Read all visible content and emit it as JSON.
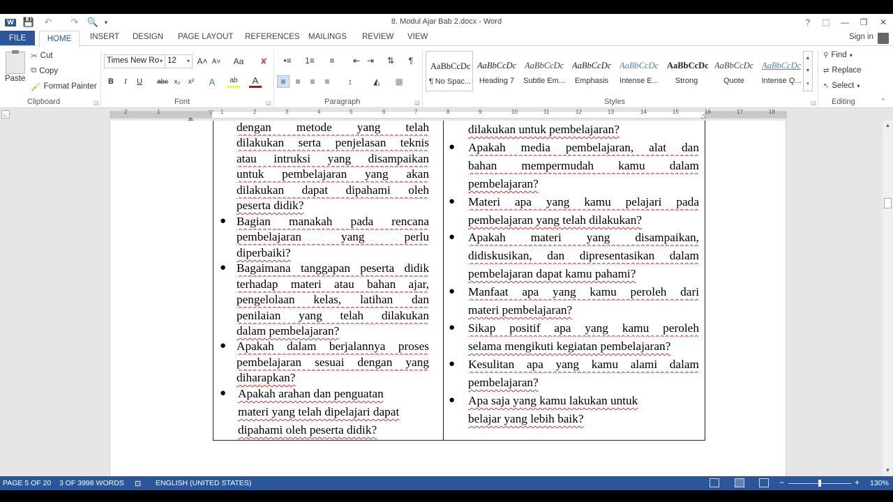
{
  "window": {
    "title": "8. Modul Ajar Bab 2.docx - Word",
    "help": "?",
    "ribbon_display": "⬚",
    "minimize": "—",
    "restore": "❐",
    "close": "✕"
  },
  "quick_access": {
    "save": "💾",
    "undo": "↶",
    "redo": "↷",
    "preview": "🔍",
    "customize": "▾"
  },
  "tabs": {
    "file": "FILE",
    "home": "HOME",
    "insert": "INSERT",
    "design": "DESIGN",
    "page_layout": "PAGE LAYOUT",
    "references": "REFERENCES",
    "mailings": "MAILINGS",
    "review": "REVIEW",
    "view": "VIEW",
    "sign_in": "Sign in"
  },
  "clipboard": {
    "paste": "Paste",
    "cut": "Cut",
    "copy": "Copy",
    "format_painter": "Format Painter",
    "label": "Clipboard"
  },
  "font": {
    "name": "Times New Ro",
    "size": "12",
    "label": "Font",
    "grow": "A˄",
    "shrink": "A˅",
    "change_case": "Aa",
    "clear": "✘",
    "bold": "B",
    "italic": "I",
    "underline": "U",
    "strike": "abc",
    "subscript": "x₂",
    "superscript": "x²",
    "effects": "A",
    "highlight": "ab",
    "color": "A"
  },
  "paragraph": {
    "label": "Paragraph",
    "bullets": "•≡",
    "numbering": "1≡",
    "multilevel": "≡",
    "decrease_indent": "⇤",
    "increase_indent": "⇥",
    "sort": "⇅",
    "show_marks": "¶",
    "align_left": "≡",
    "center": "≡",
    "align_right": "≡",
    "justify": "≡",
    "spacing": "↕",
    "shading": "◭",
    "borders": "▦"
  },
  "styles": {
    "label": "Styles",
    "items": [
      {
        "preview": "AaBbCcDc",
        "name": "¶ No Spac..."
      },
      {
        "preview": "AaBbCcDc",
        "name": "Heading 7"
      },
      {
        "preview": "AaBbCcDc",
        "name": "Subtle Em..."
      },
      {
        "preview": "AaBbCcDc",
        "name": "Emphasis"
      },
      {
        "preview": "AaBbCcDc",
        "name": "Intense E..."
      },
      {
        "preview": "AaBbCcDc",
        "name": "Strong"
      },
      {
        "preview": "AaBbCcDc",
        "name": "Quote"
      },
      {
        "preview": "AaBbCcDc",
        "name": "Intense Q..."
      }
    ]
  },
  "editing": {
    "label": "Editing",
    "find": "Find",
    "replace": "Replace",
    "select": "Select"
  },
  "ruler": {
    "numbers": [
      "2",
      "1",
      "1",
      "2",
      "3",
      "4",
      "5",
      "6",
      "7",
      "8",
      "9",
      "10",
      "11",
      "12",
      "13",
      "14",
      "15",
      "16",
      "17",
      "18"
    ]
  },
  "document": {
    "left": {
      "lines": [
        "dengan metode yang telah",
        "dilakukan serta penjelasan teknis",
        "atau intruksi yang disampaikan",
        "untuk pembelajaran yang akan",
        "dilakukan dapat dipahami oleh",
        "peserta didik?",
        "Bagian manakah pada rencana",
        "pembelajaran yang perlu",
        "diperbaiki?",
        "Bagaimana tanggapan peserta didik",
        "terhadap materi atau bahan ajar,",
        "pengelolaan kelas, latihan dan",
        "penilaian yang telah dilakukan",
        "dalam pembelajaran?",
        "Apakah dalam berjalannya proses",
        "pembelajaran sesuai dengan yang",
        "diharapkan?",
        "Apakah arahan dan penguatan",
        "materi yang telah dipelajari dapat",
        "dipahami oleh peserta didik?"
      ]
    },
    "right": {
      "lines": [
        "dilakukan untuk pembelajaran?",
        "Apakah media pembelajaran, alat dan",
        "bahan mempermudah kamu dalam",
        "pembelajaran?",
        "Materi apa yang kamu pelajari pada",
        "pembelajaran yang telah dilakukan?",
        "Apakah materi yang disampaikan,",
        "didiskusikan, dan dipresentasikan dalam",
        "pembelajaran dapat kamu pahami?",
        "Manfaat apa yang kamu peroleh dari",
        "materi pembelajaran?",
        "Sikap positif apa yang kamu peroleh",
        "selama mengikuti kegiatan pembelajaran?",
        "Kesulitan apa yang kamu alami dalam",
        "pembelajaran?",
        "Apa saja yang kamu lakukan untuk",
        "belajar yang lebih baik?"
      ]
    },
    "bullet": "●"
  },
  "status": {
    "page": "PAGE 5 OF 20",
    "words": "3 OF 3998 WORDS",
    "language": "ENGLISH (UNITED STATES)",
    "zoom_out": "−",
    "zoom_in": "+",
    "zoom": "130%",
    "zoom_fraction": 0.5
  }
}
